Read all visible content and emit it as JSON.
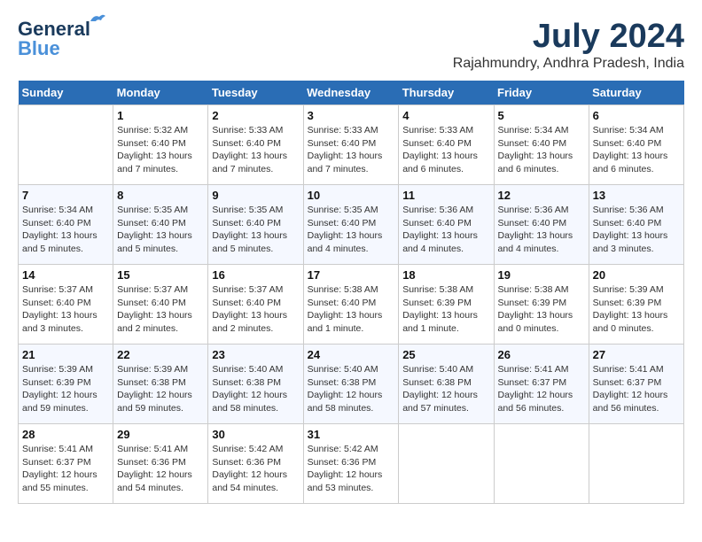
{
  "logo": {
    "line1": "General",
    "line2": "Blue"
  },
  "header": {
    "month_year": "July 2024",
    "location": "Rajahmundry, Andhra Pradesh, India"
  },
  "weekdays": [
    "Sunday",
    "Monday",
    "Tuesday",
    "Wednesday",
    "Thursday",
    "Friday",
    "Saturday"
  ],
  "weeks": [
    [
      {
        "day": "",
        "info": ""
      },
      {
        "day": "1",
        "info": "Sunrise: 5:32 AM\nSunset: 6:40 PM\nDaylight: 13 hours\nand 7 minutes."
      },
      {
        "day": "2",
        "info": "Sunrise: 5:33 AM\nSunset: 6:40 PM\nDaylight: 13 hours\nand 7 minutes."
      },
      {
        "day": "3",
        "info": "Sunrise: 5:33 AM\nSunset: 6:40 PM\nDaylight: 13 hours\nand 7 minutes."
      },
      {
        "day": "4",
        "info": "Sunrise: 5:33 AM\nSunset: 6:40 PM\nDaylight: 13 hours\nand 6 minutes."
      },
      {
        "day": "5",
        "info": "Sunrise: 5:34 AM\nSunset: 6:40 PM\nDaylight: 13 hours\nand 6 minutes."
      },
      {
        "day": "6",
        "info": "Sunrise: 5:34 AM\nSunset: 6:40 PM\nDaylight: 13 hours\nand 6 minutes."
      }
    ],
    [
      {
        "day": "7",
        "info": "Sunrise: 5:34 AM\nSunset: 6:40 PM\nDaylight: 13 hours\nand 5 minutes."
      },
      {
        "day": "8",
        "info": "Sunrise: 5:35 AM\nSunset: 6:40 PM\nDaylight: 13 hours\nand 5 minutes."
      },
      {
        "day": "9",
        "info": "Sunrise: 5:35 AM\nSunset: 6:40 PM\nDaylight: 13 hours\nand 5 minutes."
      },
      {
        "day": "10",
        "info": "Sunrise: 5:35 AM\nSunset: 6:40 PM\nDaylight: 13 hours\nand 4 minutes."
      },
      {
        "day": "11",
        "info": "Sunrise: 5:36 AM\nSunset: 6:40 PM\nDaylight: 13 hours\nand 4 minutes."
      },
      {
        "day": "12",
        "info": "Sunrise: 5:36 AM\nSunset: 6:40 PM\nDaylight: 13 hours\nand 4 minutes."
      },
      {
        "day": "13",
        "info": "Sunrise: 5:36 AM\nSunset: 6:40 PM\nDaylight: 13 hours\nand 3 minutes."
      }
    ],
    [
      {
        "day": "14",
        "info": "Sunrise: 5:37 AM\nSunset: 6:40 PM\nDaylight: 13 hours\nand 3 minutes."
      },
      {
        "day": "15",
        "info": "Sunrise: 5:37 AM\nSunset: 6:40 PM\nDaylight: 13 hours\nand 2 minutes."
      },
      {
        "day": "16",
        "info": "Sunrise: 5:37 AM\nSunset: 6:40 PM\nDaylight: 13 hours\nand 2 minutes."
      },
      {
        "day": "17",
        "info": "Sunrise: 5:38 AM\nSunset: 6:40 PM\nDaylight: 13 hours\nand 1 minute."
      },
      {
        "day": "18",
        "info": "Sunrise: 5:38 AM\nSunset: 6:39 PM\nDaylight: 13 hours\nand 1 minute."
      },
      {
        "day": "19",
        "info": "Sunrise: 5:38 AM\nSunset: 6:39 PM\nDaylight: 13 hours\nand 0 minutes."
      },
      {
        "day": "20",
        "info": "Sunrise: 5:39 AM\nSunset: 6:39 PM\nDaylight: 13 hours\nand 0 minutes."
      }
    ],
    [
      {
        "day": "21",
        "info": "Sunrise: 5:39 AM\nSunset: 6:39 PM\nDaylight: 12 hours\nand 59 minutes."
      },
      {
        "day": "22",
        "info": "Sunrise: 5:39 AM\nSunset: 6:38 PM\nDaylight: 12 hours\nand 59 minutes."
      },
      {
        "day": "23",
        "info": "Sunrise: 5:40 AM\nSunset: 6:38 PM\nDaylight: 12 hours\nand 58 minutes."
      },
      {
        "day": "24",
        "info": "Sunrise: 5:40 AM\nSunset: 6:38 PM\nDaylight: 12 hours\nand 58 minutes."
      },
      {
        "day": "25",
        "info": "Sunrise: 5:40 AM\nSunset: 6:38 PM\nDaylight: 12 hours\nand 57 minutes."
      },
      {
        "day": "26",
        "info": "Sunrise: 5:41 AM\nSunset: 6:37 PM\nDaylight: 12 hours\nand 56 minutes."
      },
      {
        "day": "27",
        "info": "Sunrise: 5:41 AM\nSunset: 6:37 PM\nDaylight: 12 hours\nand 56 minutes."
      }
    ],
    [
      {
        "day": "28",
        "info": "Sunrise: 5:41 AM\nSunset: 6:37 PM\nDaylight: 12 hours\nand 55 minutes."
      },
      {
        "day": "29",
        "info": "Sunrise: 5:41 AM\nSunset: 6:36 PM\nDaylight: 12 hours\nand 54 minutes."
      },
      {
        "day": "30",
        "info": "Sunrise: 5:42 AM\nSunset: 6:36 PM\nDaylight: 12 hours\nand 54 minutes."
      },
      {
        "day": "31",
        "info": "Sunrise: 5:42 AM\nSunset: 6:36 PM\nDaylight: 12 hours\nand 53 minutes."
      },
      {
        "day": "",
        "info": ""
      },
      {
        "day": "",
        "info": ""
      },
      {
        "day": "",
        "info": ""
      }
    ]
  ]
}
